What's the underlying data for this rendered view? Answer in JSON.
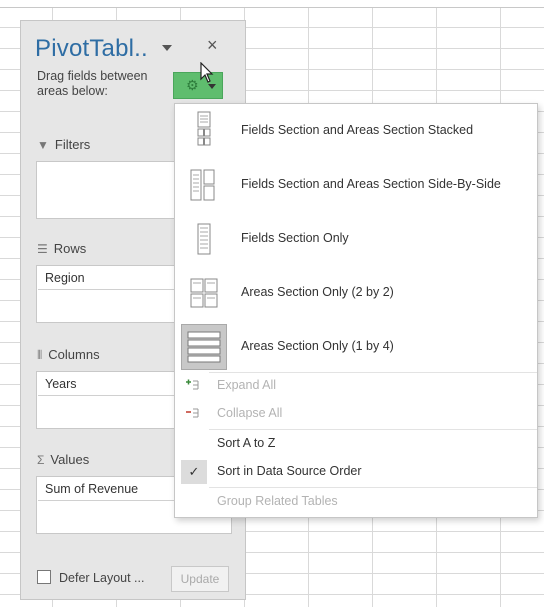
{
  "pane": {
    "title": "PivotTabl..",
    "close_label": "×",
    "drag_text": "Drag fields between areas below:",
    "sections": {
      "filters": {
        "label": "Filters",
        "items": []
      },
      "rows": {
        "label": "Rows",
        "items": [
          "Region"
        ]
      },
      "columns": {
        "label": "Columns",
        "items": [
          "Years"
        ]
      },
      "values": {
        "label": "Values",
        "items": [
          "Sum of Revenue"
        ]
      }
    },
    "defer_label": "Defer Layout ...",
    "update_label": "Update"
  },
  "menu": {
    "layouts": [
      {
        "label": "Fields Section and Areas Section Stacked",
        "icon": "layout-stacked-icon",
        "selected": false
      },
      {
        "label": "Fields Section and Areas Section Side-By-Side",
        "icon": "layout-side-by-side-icon",
        "selected": false
      },
      {
        "label": "Fields Section Only",
        "icon": "layout-fields-only-icon",
        "selected": false
      },
      {
        "label": "Areas Section Only (2 by 2)",
        "icon": "layout-areas-2x2-icon",
        "selected": false
      },
      {
        "label": "Areas Section Only (1 by 4)",
        "icon": "layout-areas-1x4-icon",
        "selected": true
      }
    ],
    "expand_all": "Expand All",
    "collapse_all": "Collapse All",
    "sort_a_z": "Sort A to Z",
    "sort_source": "Sort in Data Source Order",
    "group_related": "Group Related Tables"
  },
  "colors": {
    "accent": "#2e6da4",
    "gear_button": "#5fbd6e"
  }
}
